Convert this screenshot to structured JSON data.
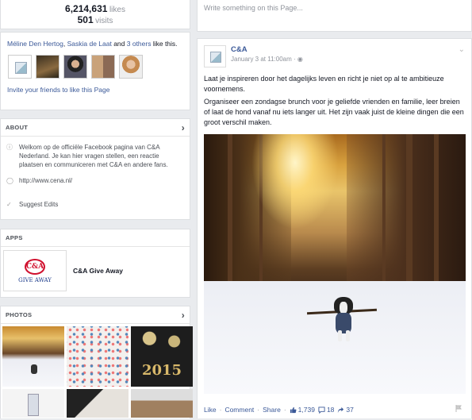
{
  "stats": {
    "likes_count": "6,214,631",
    "likes_label": "likes",
    "visits_count": "501",
    "visits_label": "visits"
  },
  "friends": {
    "name1": "Méline Den Hertog",
    "sep1": ", ",
    "name2": "Saskia de Laat",
    "sep2": " and ",
    "others": "3 others",
    "suffix": " like this.",
    "invite": "Invite your friends to like this Page"
  },
  "about": {
    "header": "ABOUT",
    "description": "Welkom op de officiële Facebook pagina van C&A Nederland. Je kan hier vragen stellen, een reactie plaatsen en communiceren met C&A en andere fans.",
    "website": "http://www.cena.nl/",
    "suggest": "Suggest Edits"
  },
  "apps": {
    "header": "APPS",
    "logo_text": "C&A",
    "logo_sub": "GIVE AWAY",
    "app_name": "C&A Give Away"
  },
  "photos": {
    "header": "PHOTOS",
    "tile_text": "2015"
  },
  "composer": {
    "placeholder": "Write something on this Page..."
  },
  "post": {
    "page_name": "C&A",
    "date": "January 3 at 11:00am",
    "date_sep": " · ",
    "paragraph1": "Laat je inspireren door het dagelijks leven en richt je niet op al te ambitieuze voornemens.",
    "paragraph2": "Organiseer een zondagse brunch voor je geliefde vrienden en familie, leer breien of laat de hond vanaf nu iets langer uit. Het zijn vaak juist de kleine dingen die een groot verschil maken.",
    "like": "Like",
    "comment": "Comment",
    "share": "Share",
    "dot": "·",
    "likes": "1,739",
    "comments": "18",
    "shares": "37"
  },
  "colors": {
    "link": "#3b5998",
    "brand_red": "#d0102e",
    "background": "#e9ebee"
  }
}
